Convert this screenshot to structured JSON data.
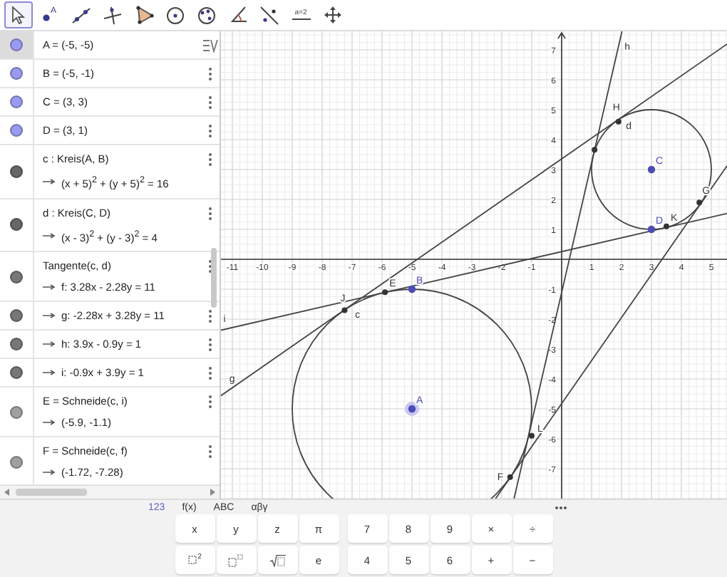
{
  "toolbar": [
    {
      "kind": "move",
      "selected": true
    },
    {
      "kind": "point",
      "label": "A",
      "selected": false
    },
    {
      "kind": "line",
      "selected": false
    },
    {
      "kind": "perpendicular",
      "selected": false
    },
    {
      "kind": "polygon",
      "selected": false
    },
    {
      "kind": "circle-center",
      "selected": false
    },
    {
      "kind": "circle-three",
      "selected": false
    },
    {
      "kind": "angle",
      "selected": false
    },
    {
      "kind": "reflect",
      "selected": false
    },
    {
      "kind": "slider",
      "label": "a=2",
      "selected": false
    },
    {
      "kind": "move-view",
      "selected": false
    }
  ],
  "algebra": {
    "rows": [
      {
        "definition": "A = (-5, -5)",
        "color": "#9a9af0",
        "selected": true
      },
      {
        "definition": "B = (-5, -1)",
        "color": "#9a9af0",
        "selected": false
      },
      {
        "definition": "C = (3, 3)",
        "color": "#9a9af0",
        "selected": false
      },
      {
        "definition": "D = (3, 1)",
        "color": "#9a9af0",
        "selected": false
      },
      {
        "definition": "c : Kreis(A, B)",
        "value": "(x + 5)$^{2}$ + (y + 5)$^{2}$ = 16",
        "color": "#666666",
        "selected": false
      },
      {
        "definition": "d : Kreis(C, D)",
        "value": "(x - 3)$^{2}$ + (y - 3)$^{2}$ = 4",
        "color": "#666666",
        "selected": false
      },
      {
        "definition": "Tangente(c, d)",
        "value": "f: 3.28x - 2.28y = 11",
        "color": "#777777",
        "selected": false
      },
      {
        "value": "g: -2.28x + 3.28y = 11",
        "color": "#777777",
        "selected": false
      },
      {
        "value": "h: 3.9x - 0.9y = 1",
        "color": "#777777",
        "selected": false
      },
      {
        "value": "i: -0.9x + 3.9y = 1",
        "color": "#777777",
        "selected": false
      },
      {
        "definition": "E = Schneide(c, i)",
        "value": "(-5.9, -1.1)",
        "color": "#a0a0a0",
        "selected": false
      },
      {
        "definition": "F = Schneide(c, f)",
        "value": "(-1.72, -7.28)",
        "color": "#a0a0a0",
        "selected": false
      }
    ]
  },
  "graph": {
    "x_ticks": [
      "-11",
      "-10",
      "-9",
      "-8",
      "-7",
      "-6",
      "-5",
      "-4",
      "-3",
      "-2",
      "-1",
      "1",
      "2",
      "3",
      "4",
      "5"
    ],
    "y_ticks": [
      "7",
      "6",
      "5",
      "4",
      "3",
      "2",
      "1",
      "-1",
      "-2",
      "-3",
      "-4",
      "-5",
      "-6",
      "-7"
    ],
    "curves": [
      {
        "kind": "circle",
        "label": "c"
      },
      {
        "kind": "circle",
        "label": "d"
      },
      {
        "kind": "line"
      },
      {
        "kind": "line",
        "label": "g"
      },
      {
        "kind": "line",
        "label": "h"
      },
      {
        "kind": "line",
        "label": "i"
      }
    ],
    "points": [
      {
        "label": "A",
        "kind": "free",
        "selected": true
      },
      {
        "label": "B",
        "kind": "free",
        "selected": false
      },
      {
        "label": "C",
        "kind": "free",
        "selected": false
      },
      {
        "label": "D",
        "kind": "free",
        "selected": false
      },
      {
        "label": "E",
        "kind": "dependent",
        "selected": false
      },
      {
        "label": "F",
        "kind": "dependent",
        "selected": false
      },
      {
        "label": "G",
        "kind": "dependent",
        "selected": false
      },
      {
        "label": "H",
        "kind": "dependent",
        "selected": false
      },
      {
        "label": "J",
        "kind": "dependent",
        "selected": false
      },
      {
        "label": "K",
        "kind": "dependent",
        "selected": false
      },
      {
        "label": "L",
        "kind": "dependent",
        "selected": false
      },
      {
        "kind": "dependent",
        "selected": false
      }
    ]
  },
  "keyboard": {
    "tabs": [
      {
        "label": "123",
        "selected": true
      },
      {
        "label": "f(x)",
        "selected": false
      },
      {
        "label": "ABC",
        "selected": false
      },
      {
        "label": "αβγ",
        "selected": false
      }
    ],
    "rows": [
      {
        "left": [
          {
            "kind": "text",
            "label": "x"
          },
          {
            "kind": "text",
            "label": "y"
          },
          {
            "kind": "text",
            "label": "z"
          },
          {
            "kind": "text",
            "label": "π"
          }
        ],
        "right": [
          {
            "kind": "text",
            "label": "7"
          },
          {
            "kind": "text",
            "label": "8"
          },
          {
            "kind": "text",
            "label": "9"
          },
          {
            "kind": "text",
            "label": "×"
          },
          {
            "kind": "text",
            "label": "÷"
          }
        ]
      },
      {
        "left": [
          {
            "kind": "square",
            "exponent": "2"
          },
          {
            "kind": "power"
          },
          {
            "kind": "sqrt"
          },
          {
            "kind": "text",
            "label": "e"
          }
        ],
        "right": [
          {
            "kind": "text",
            "label": "4"
          },
          {
            "kind": "text",
            "label": "5"
          },
          {
            "kind": "text",
            "label": "6"
          },
          {
            "kind": "text",
            "label": "+"
          },
          {
            "kind": "text",
            "label": "−"
          }
        ]
      }
    ]
  }
}
